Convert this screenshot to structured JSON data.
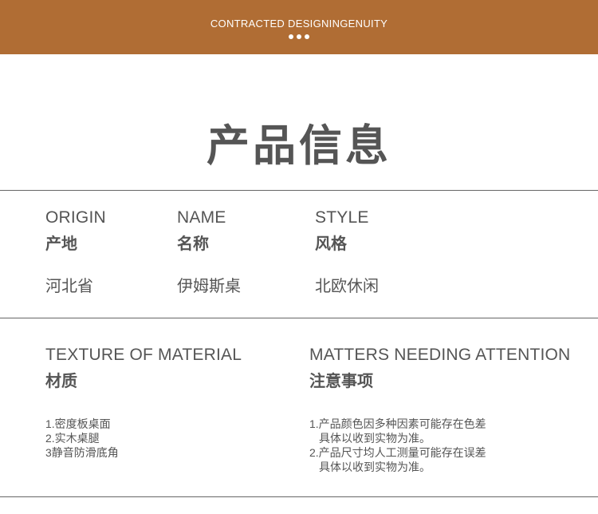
{
  "banner": {
    "text": "CONTRACTED DESIGNINGENUITY",
    "dots": 3,
    "color": "#b06d34"
  },
  "title": "产品信息",
  "info": {
    "origin": {
      "label_en": "ORIGIN",
      "label_cn": "产地",
      "value": "河北省"
    },
    "name": {
      "label_en": "NAME",
      "label_cn": "名称",
      "value": "伊姆斯桌"
    },
    "style": {
      "label_en": "STYLE",
      "label_cn": "风格",
      "value": "北欧休闲"
    }
  },
  "material": {
    "label_en": "TEXTURE OF MATERIAL",
    "label_cn": "材质",
    "items": [
      "1.密度板桌面",
      "2.实木桌腿",
      "3静音防滑底角"
    ]
  },
  "attention": {
    "label_en": "MATTERS NEEDING ATTENTION",
    "label_cn": "注意事项",
    "items": [
      {
        "line1": "1.产品颜色因多种因素可能存在色差",
        "line2": "具体以收到实物为准。"
      },
      {
        "line1": "2.产品尺寸均人工测量可能存在误差",
        "line2": "具体以收到实物为准。"
      }
    ]
  }
}
